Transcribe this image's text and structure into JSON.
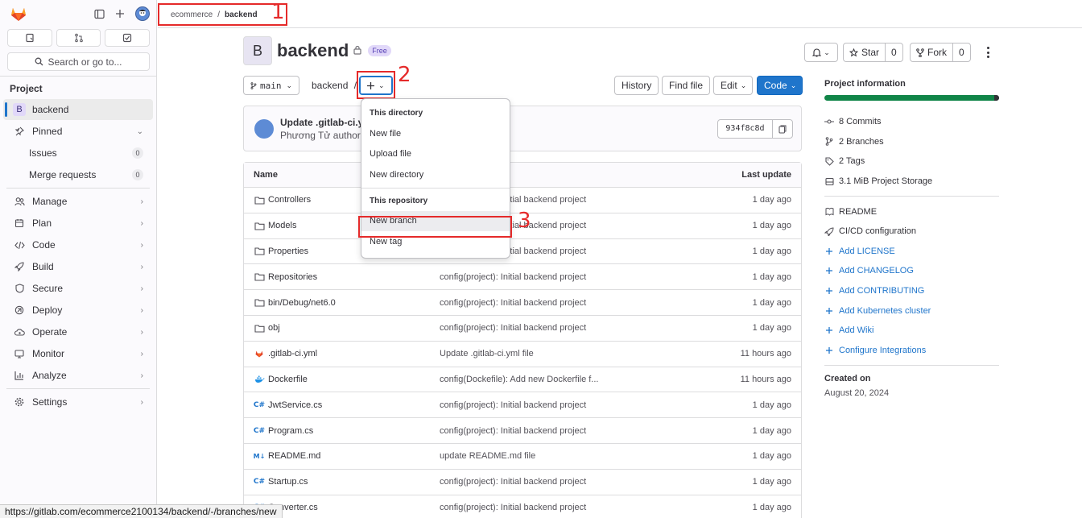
{
  "breadcrumb": {
    "group": "ecommerce",
    "sep": "/",
    "project": "backend"
  },
  "annotations": {
    "one": "1",
    "two": "2",
    "three": "3"
  },
  "sidebar": {
    "search_label": "Search or go to...",
    "section": "Project",
    "project_item": {
      "letter": "B",
      "label": "backend"
    },
    "items": [
      {
        "label": "Pinned"
      },
      {
        "label": "Issues",
        "count": "0"
      },
      {
        "label": "Merge requests",
        "count": "0"
      },
      {
        "label": "Manage"
      },
      {
        "label": "Plan"
      },
      {
        "label": "Code"
      },
      {
        "label": "Build"
      },
      {
        "label": "Secure"
      },
      {
        "label": "Deploy"
      },
      {
        "label": "Operate"
      },
      {
        "label": "Monitor"
      },
      {
        "label": "Analyze"
      },
      {
        "label": "Settings"
      }
    ]
  },
  "project": {
    "avatar_letter": "B",
    "title": "backend",
    "badge": "Free"
  },
  "header_buttons": {
    "star": "Star",
    "star_count": "0",
    "fork": "Fork",
    "fork_count": "0"
  },
  "toolbar": {
    "branch": "main",
    "path": "backend",
    "path_sep": "/",
    "history": "History",
    "find_file": "Find file",
    "edit": "Edit",
    "code": "Code"
  },
  "commit": {
    "title": "Update .gitlab-ci.yml",
    "author": "Phương Tử",
    "action": "authored",
    "sha": "934f8c8d"
  },
  "table": {
    "headers": {
      "name": "Name",
      "last_update": "Last update"
    },
    "rows": [
      {
        "icon": "folder-icon",
        "name": "Controllers",
        "msg": "config(project): Initial backend project",
        "updated": "1 day ago"
      },
      {
        "icon": "folder-icon",
        "name": "Models",
        "msg": "config(project): Initial backend project",
        "updated": "1 day ago"
      },
      {
        "icon": "folder-icon",
        "name": "Properties",
        "msg": "config(project): Initial backend project",
        "updated": "1 day ago"
      },
      {
        "icon": "folder-icon",
        "name": "Repositories",
        "msg": "config(project): Initial backend project",
        "updated": "1 day ago"
      },
      {
        "icon": "folder-icon",
        "name": "bin/Debug/net6.0",
        "msg": "config(project): Initial backend project",
        "updated": "1 day ago"
      },
      {
        "icon": "folder-icon",
        "name": "obj",
        "msg": "config(project): Initial backend project",
        "updated": "1 day ago"
      },
      {
        "icon": "gitlab-icon",
        "name": ".gitlab-ci.yml",
        "msg": "Update .gitlab-ci.yml file",
        "updated": "11 hours ago"
      },
      {
        "icon": "docker-icon",
        "name": "Dockerfile",
        "msg": "config(Dockefile): Add new Dockerfile f...",
        "updated": "11 hours ago"
      },
      {
        "icon": "csharp-icon",
        "name": "JwtService.cs",
        "msg": "config(project): Initial backend project",
        "updated": "1 day ago"
      },
      {
        "icon": "csharp-icon",
        "name": "Program.cs",
        "msg": "config(project): Initial backend project",
        "updated": "1 day ago"
      },
      {
        "icon": "markdown-icon",
        "name": "README.md",
        "msg": "update README.md file",
        "updated": "1 day ago"
      },
      {
        "icon": "csharp-icon",
        "name": "Startup.cs",
        "msg": "config(project): Initial backend project",
        "updated": "1 day ago"
      },
      {
        "icon": "csharp-icon",
        "name": "Converter.cs",
        "msg": "config(project): Initial backend project",
        "updated": "1 day ago"
      }
    ]
  },
  "dropdown": {
    "section1": "This directory",
    "items1": [
      "New file",
      "Upload file",
      "New directory"
    ],
    "section2": "This repository",
    "items2": [
      "New branch",
      "New tag"
    ]
  },
  "project_info": {
    "title": "Project information",
    "stats": [
      {
        "icon": "commit-icon",
        "label": "8 Commits"
      },
      {
        "icon": "branch-icon",
        "label": "2 Branches"
      },
      {
        "icon": "tag-icon",
        "label": "2 Tags"
      },
      {
        "icon": "storage-icon",
        "label": "3.1 MiB Project Storage"
      }
    ],
    "links": [
      {
        "icon": "readme-icon",
        "label": "README",
        "kind": "plain"
      },
      {
        "icon": "cicd-icon",
        "label": "CI/CD configuration",
        "kind": "plain"
      },
      {
        "icon": "plus-icon",
        "label": "Add LICENSE",
        "kind": "link"
      },
      {
        "icon": "plus-icon",
        "label": "Add CHANGELOG",
        "kind": "link"
      },
      {
        "icon": "plus-icon",
        "label": "Add CONTRIBUTING",
        "kind": "link"
      },
      {
        "icon": "plus-icon",
        "label": "Add Kubernetes cluster",
        "kind": "link"
      },
      {
        "icon": "plus-icon",
        "label": "Add Wiki",
        "kind": "link"
      },
      {
        "icon": "plus-icon",
        "label": "Configure Integrations",
        "kind": "link"
      }
    ],
    "created_label": "Created on",
    "created_date": "August 20, 2024"
  },
  "status_url": "https://gitlab.com/ecommerce2100134/backend/-/branches/new",
  "colors": {
    "accent": "#1f75cb",
    "annotation": "#e52a2a",
    "progress": "#108548"
  }
}
